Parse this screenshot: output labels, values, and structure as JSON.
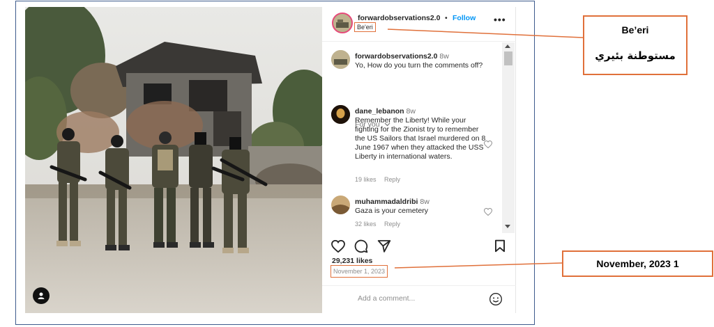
{
  "post": {
    "username": "forwardobservations2.0",
    "separator": "•",
    "follow_label": "Follow",
    "location": "Be'eri",
    "more_icon": "•••",
    "icons": {
      "more": "more-options-icon",
      "like": "heart-icon",
      "comment": "comment-icon",
      "share": "share-icon",
      "save": "bookmark-icon",
      "emoji": "emoji-icon",
      "profile_badge": "user-tag-icon"
    }
  },
  "comments": [
    {
      "username": "forwardobservations2.0",
      "time": "8w",
      "text": "Yo, How do you turn the comments off?",
      "likes": "",
      "reply": ""
    },
    {
      "username": "dane_lebanon",
      "time": "8w",
      "text": "Remember the Liberty! While your fighting for the Zionist try to remember the US Sailors that Israel murdered on 8 June 1967 when they attacked the USS Liberty in international waters.",
      "likes": "19 likes",
      "reply": "Reply"
    },
    {
      "username": "muhammadaldribi",
      "time": "8w",
      "text": "Gaza is your cemetery",
      "likes": "32 likes",
      "reply": "Reply"
    }
  ],
  "for_you_label": "For you",
  "likes_count": "29,231 likes",
  "post_date": "November 1, 2023",
  "add_comment_placeholder": "Add a comment...",
  "annotations": {
    "location_title": "Be’eri",
    "location_arabic": "مستوطنة بئيري",
    "date_label": "November, 2023 1"
  },
  "colors": {
    "frame": "#3d5a8c",
    "callout_border": "#e0703a",
    "follow": "#0095f6",
    "story_ring": "#e7497a"
  }
}
